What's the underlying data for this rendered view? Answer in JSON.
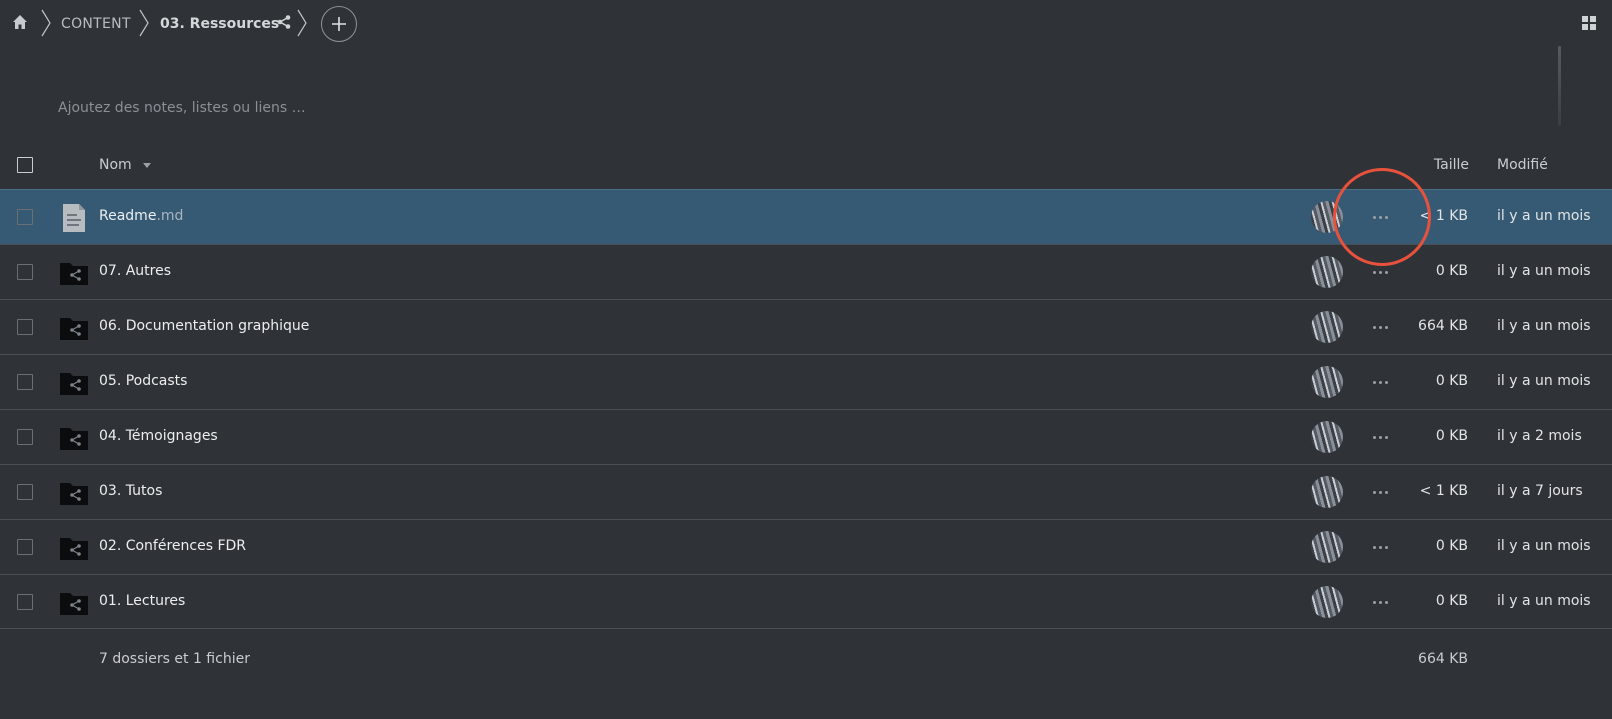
{
  "breadcrumb": {
    "items": [
      "CONTENT",
      "03. Ressources"
    ]
  },
  "notes": {
    "placeholder": "Ajoutez des notes, listes ou liens …"
  },
  "table": {
    "headers": {
      "name": "Nom",
      "size": "Taille",
      "modified": "Modifié"
    },
    "rows": [
      {
        "name": "Readme",
        "ext": ".md",
        "type": "file",
        "size": "< 1 KB",
        "modified": "il y a un mois",
        "selected": true
      },
      {
        "name": "07. Autres",
        "ext": "",
        "type": "shared-folder",
        "size": "0 KB",
        "modified": "il y a un mois"
      },
      {
        "name": "06. Documentation graphique",
        "ext": "",
        "type": "shared-folder",
        "size": "664 KB",
        "modified": "il y a un mois"
      },
      {
        "name": "05. Podcasts",
        "ext": "",
        "type": "shared-folder",
        "size": "0 KB",
        "modified": "il y a un mois"
      },
      {
        "name": "04. Témoignages",
        "ext": "",
        "type": "shared-folder",
        "size": "0 KB",
        "modified": "il y a 2 mois"
      },
      {
        "name": "03. Tutos",
        "ext": "",
        "type": "shared-folder",
        "size": "< 1 KB",
        "modified": "il y a 7 jours"
      },
      {
        "name": "02. Conférences FDR",
        "ext": "",
        "type": "shared-folder",
        "size": "0 KB",
        "modified": "il y a un mois"
      },
      {
        "name": "01. Lectures",
        "ext": "",
        "type": "shared-folder",
        "size": "0 KB",
        "modified": "il y a un mois"
      }
    ]
  },
  "summary": {
    "text": "7 dossiers et 1 fichier",
    "total_size": "664 KB"
  },
  "colors": {
    "background": "#2f3337",
    "selected_row": "#365a74",
    "highlight": "#e8523c"
  }
}
